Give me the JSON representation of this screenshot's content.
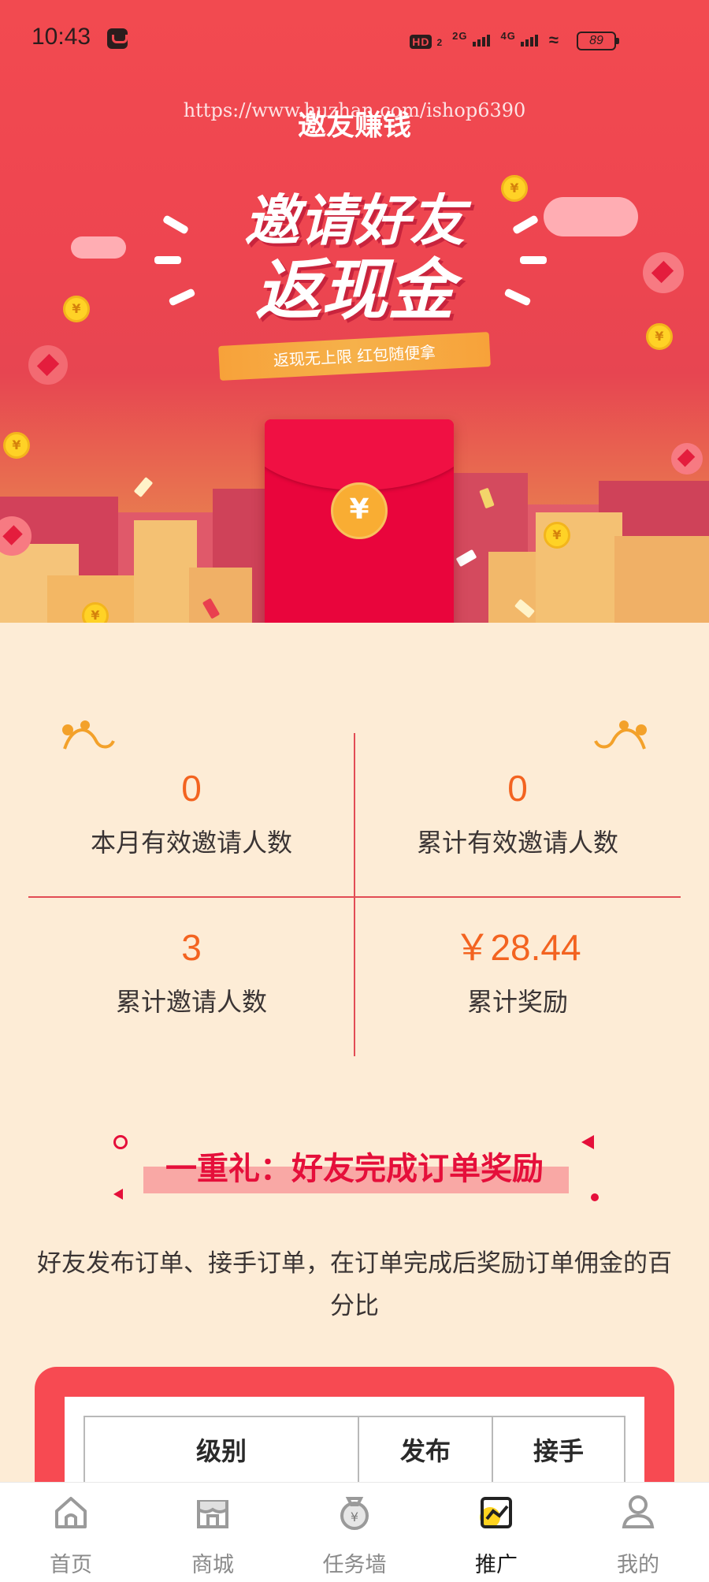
{
  "status_bar": {
    "time": "10:43",
    "network_a": "2G",
    "network_b": "4G",
    "sim": "HD",
    "battery": "89"
  },
  "header": {
    "title": "邀友赚钱",
    "watermark": "https://www.huzhan.com/ishop6390"
  },
  "banner": {
    "headline_line1": "邀请好友",
    "headline_line2": "返现金",
    "ribbon": "返现无上限 红包随便拿",
    "envelope_symbol": "¥",
    "coin_symbol": "¥"
  },
  "stats": {
    "month_valid_invites": {
      "value": "0",
      "label": "本月有效邀请人数"
    },
    "total_valid_invites": {
      "value": "0",
      "label": "累计有效邀请人数"
    },
    "total_invites": {
      "value": "3",
      "label": "累计邀请人数"
    },
    "total_reward": {
      "value": "￥28.44",
      "label": "累计奖励"
    }
  },
  "gift": {
    "title": "一重礼：好友完成订单奖励",
    "description": "好友发布订单、接手订单，在订单完成后奖励订单佣金的百分比"
  },
  "reward_table": {
    "columns": [
      "级别",
      "发布",
      "接手"
    ]
  },
  "bottom_nav": {
    "items": [
      {
        "label": "首页",
        "icon": "home-icon"
      },
      {
        "label": "商城",
        "icon": "shop-icon"
      },
      {
        "label": "任务墙",
        "icon": "money-bag-icon"
      },
      {
        "label": "推广",
        "icon": "promote-icon"
      },
      {
        "label": "我的",
        "icon": "profile-icon"
      }
    ],
    "active_index": 3
  },
  "colors": {
    "primary": "#f24a50",
    "accent_orange": "#f36320",
    "page_bg": "#fdecd6",
    "gift_red": "#e50f3a"
  }
}
